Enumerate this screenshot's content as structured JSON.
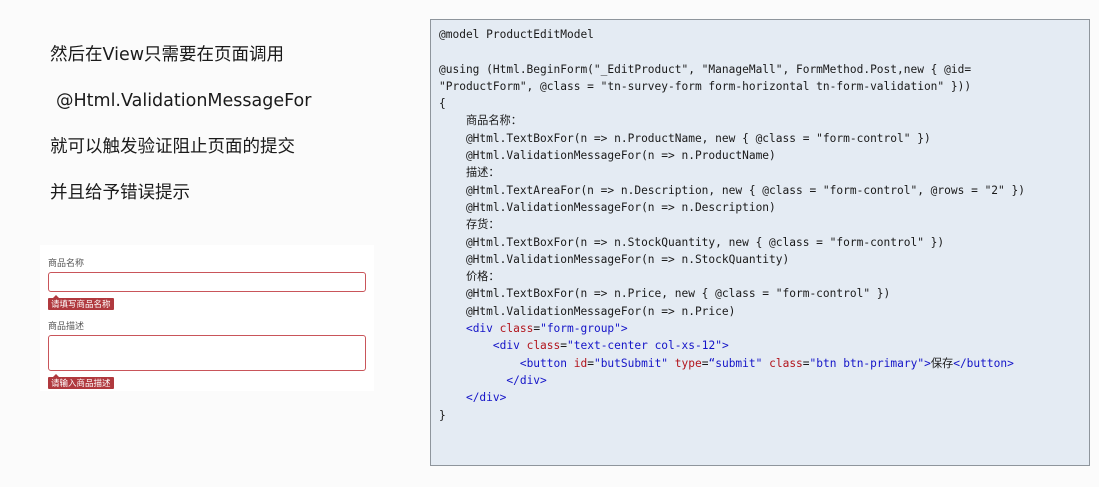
{
  "slide": {
    "lines": [
      "然后在View只需要在页面调用",
      " @Html.ValidationMessageFor",
      "就可以触发验证阻止页面的提交",
      "并且给予错误提示"
    ]
  },
  "form_preview": {
    "fields": [
      {
        "label": "商品名称",
        "error": "请填写商品名称",
        "multiline": false
      },
      {
        "label": "商品描述",
        "error": "请输入商品描述",
        "multiline": true
      }
    ]
  },
  "code": {
    "lines": [
      [
        {
          "t": "@model ProductEditModel",
          "k": "default"
        }
      ],
      [
        {
          "t": "",
          "k": "default"
        }
      ],
      [
        {
          "t": "@using (Html.BeginForm(\"_EditProduct\", \"ManageMall\", FormMethod.Post,new { @id=",
          "k": "default"
        }
      ],
      [
        {
          "t": "\"ProductForm\", @class = \"tn-survey-form form-horizontal tn-form-validation\" }))",
          "k": "default"
        }
      ],
      [
        {
          "t": "{",
          "k": "default"
        }
      ],
      [
        {
          "t": "    商品名称：",
          "k": "default"
        }
      ],
      [
        {
          "t": "    @Html.TextBoxFor(n => n.ProductName, new { @class = \"form-control\" })",
          "k": "default"
        }
      ],
      [
        {
          "t": "    @Html.ValidationMessageFor(n => n.ProductName)",
          "k": "default"
        }
      ],
      [
        {
          "t": "    描述：",
          "k": "default"
        }
      ],
      [
        {
          "t": "    @Html.TextAreaFor(n => n.Description, new { @class = \"form-control\", @rows = \"2\" })",
          "k": "default"
        }
      ],
      [
        {
          "t": "    @Html.ValidationMessageFor(n => n.Description)",
          "k": "default"
        }
      ],
      [
        {
          "t": "    存货：",
          "k": "default"
        }
      ],
      [
        {
          "t": "    @Html.TextBoxFor(n => n.StockQuantity, new { @class = \"form-control\" })",
          "k": "default"
        }
      ],
      [
        {
          "t": "    @Html.ValidationMessageFor(n => n.StockQuantity)",
          "k": "default"
        }
      ],
      [
        {
          "t": "    价格：",
          "k": "default"
        }
      ],
      [
        {
          "t": "    @Html.TextBoxFor(n => n.Price, new { @class = \"form-control\" })",
          "k": "default"
        }
      ],
      [
        {
          "t": "    @Html.ValidationMessageFor(n => n.Price)",
          "k": "default"
        }
      ],
      [
        {
          "t": "    ",
          "k": "default"
        },
        {
          "t": "<div ",
          "k": "tag"
        },
        {
          "t": "class",
          "k": "attr"
        },
        {
          "t": "=",
          "k": "default"
        },
        {
          "t": "\"form-group\"",
          "k": "str"
        },
        {
          "t": ">",
          "k": "tag"
        }
      ],
      [
        {
          "t": "        ",
          "k": "default"
        },
        {
          "t": "<div ",
          "k": "tag"
        },
        {
          "t": "class",
          "k": "attr"
        },
        {
          "t": "=",
          "k": "default"
        },
        {
          "t": "\"text-center col-xs-12\"",
          "k": "str"
        },
        {
          "t": ">",
          "k": "tag"
        }
      ],
      [
        {
          "t": "            ",
          "k": "default"
        },
        {
          "t": "<button ",
          "k": "tag"
        },
        {
          "t": "id",
          "k": "attr"
        },
        {
          "t": "=",
          "k": "default"
        },
        {
          "t": "\"butSubmit\" ",
          "k": "str"
        },
        {
          "t": "type",
          "k": "attr"
        },
        {
          "t": "=",
          "k": "default"
        },
        {
          "t": "“submit\" ",
          "k": "str"
        },
        {
          "t": "class",
          "k": "attr"
        },
        {
          "t": "=",
          "k": "default"
        },
        {
          "t": "\"btn btn-primary\"",
          "k": "str"
        },
        {
          "t": ">",
          "k": "tag"
        },
        {
          "t": "保存",
          "k": "default"
        },
        {
          "t": "</button>",
          "k": "tag"
        }
      ],
      [
        {
          "t": "          ",
          "k": "default"
        },
        {
          "t": "</div>",
          "k": "tag"
        }
      ],
      [
        {
          "t": "    ",
          "k": "default"
        },
        {
          "t": "</div>",
          "k": "tag"
        }
      ],
      [
        {
          "t": "}",
          "k": "default"
        }
      ]
    ]
  }
}
